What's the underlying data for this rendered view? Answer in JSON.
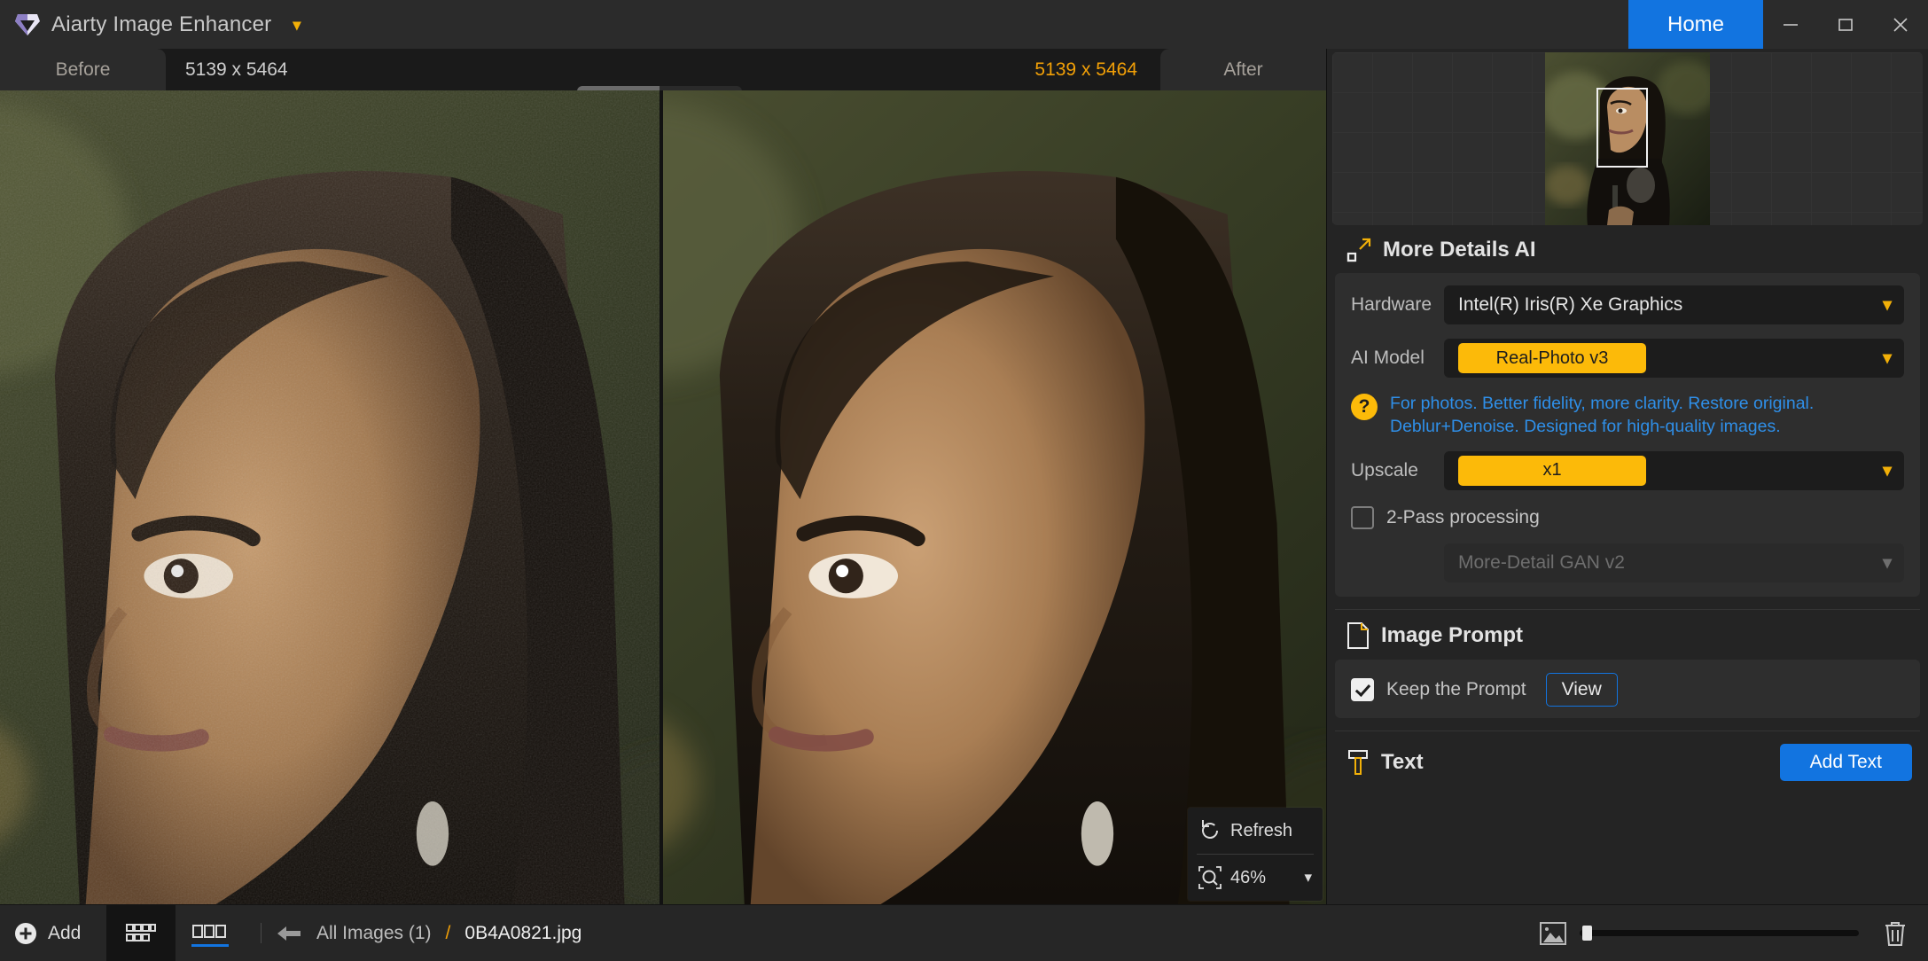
{
  "titlebar": {
    "app_name": "Aiarty Image Enhancer",
    "logo_icon": "gem-logo-icon",
    "dropdown_caret_icon": "chevron-down-icon",
    "home_label": "Home",
    "minimize_icon": "minimize-icon",
    "maximize_icon": "maximize-icon",
    "close_icon": "close-icon"
  },
  "compare_header": {
    "before_tab": "Before",
    "before_dimensions": "5139 x 5464",
    "after_dimensions": "5139 x 5464",
    "after_tab": "After",
    "view_modes": [
      {
        "name": "single-view",
        "icon": "single-pane-icon",
        "active": false
      },
      {
        "name": "split-view",
        "icon": "split-pane-icon",
        "active": true
      }
    ]
  },
  "canvas": {
    "refresh_label": "Refresh",
    "refresh_icon": "refresh-icon",
    "zoom_value": "46%",
    "zoom_icon": "zoom-magnifier-icon",
    "zoom_caret_icon": "chevron-down-icon"
  },
  "sidebar": {
    "navigator": {
      "viewport_name": "navigator-viewport"
    },
    "more_details": {
      "icon": "expand-arrow-icon",
      "title": "More Details AI",
      "hardware_label": "Hardware",
      "hardware_value": "Intel(R) Iris(R) Xe Graphics",
      "ai_model_label": "AI Model",
      "ai_model_value": "Real-Photo v3",
      "ai_model_hint": "For photos. Better fidelity, more clarity. Restore original. Deblur+Denoise. Designed for high-quality images.",
      "help_icon": "question-mark-icon",
      "upscale_label": "Upscale",
      "upscale_value": "x1",
      "two_pass_label": "2-Pass processing",
      "two_pass_checked": false,
      "second_model_value": "More-Detail GAN v2",
      "second_model_disabled": true
    },
    "image_prompt": {
      "icon": "document-icon",
      "title": "Image Prompt",
      "keep_prompt_label": "Keep the Prompt",
      "keep_prompt_checked": true,
      "view_label": "View"
    },
    "text_section": {
      "icon": "text-tool-icon",
      "title": "Text",
      "add_text_label": "Add Text"
    }
  },
  "bottombar": {
    "add_label": "Add",
    "add_icon": "plus-circle-icon",
    "grid_view_icon": "grid-view-icon",
    "filmstrip_view_icon": "filmstrip-view-icon",
    "back_icon": "back-arrow-icon",
    "breadcrumb_root": "All Images (1)",
    "breadcrumb_separator": "/",
    "breadcrumb_current": "0B4A0821.jpg",
    "thumb_size_icon": "image-size-icon",
    "delete_icon": "trash-icon"
  },
  "colors": {
    "accent_yellow": "#fcba09",
    "accent_blue": "#1274e0",
    "dim_orange": "#f2a007",
    "hint_blue": "#2f8fe8"
  }
}
